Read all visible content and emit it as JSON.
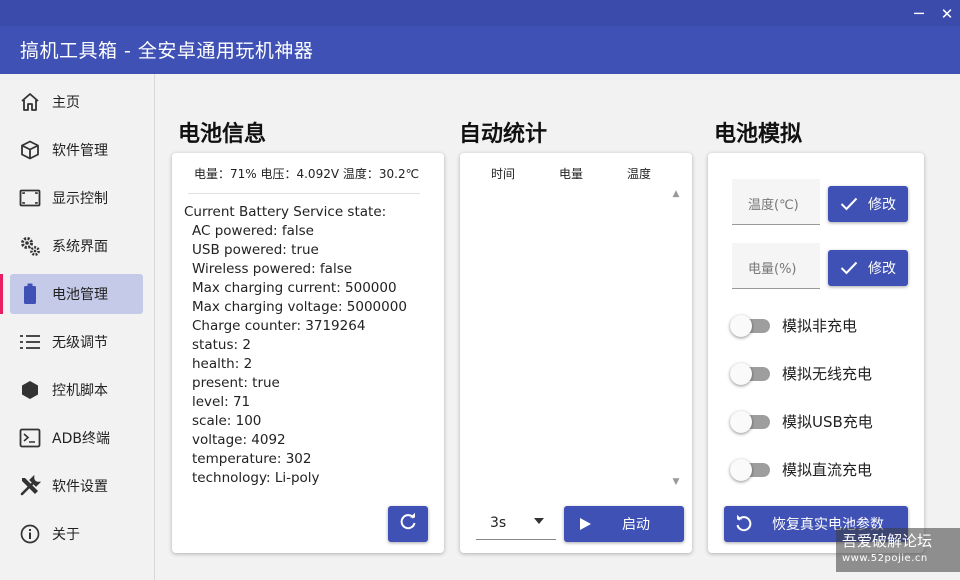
{
  "window": {
    "title": "搞机工具箱 - 全安卓通用玩机神器",
    "minimize_glyph": "─",
    "close_glyph": "✕"
  },
  "sidebar": {
    "active_index": 4,
    "items": [
      {
        "label": "主页",
        "icon": "home-icon"
      },
      {
        "label": "软件管理",
        "icon": "package-icon"
      },
      {
        "label": "显示控制",
        "icon": "screen-icon"
      },
      {
        "label": "系统界面",
        "icon": "gears-icon"
      },
      {
        "label": "电池管理",
        "icon": "battery-icon"
      },
      {
        "label": "无级调节",
        "icon": "list-icon"
      },
      {
        "label": "控机脚本",
        "icon": "hexagon-icon"
      },
      {
        "label": "ADB终端",
        "icon": "terminal-icon"
      },
      {
        "label": "软件设置",
        "icon": "tools-icon"
      },
      {
        "label": "关于",
        "icon": "info-icon"
      }
    ]
  },
  "battery_info": {
    "heading": "电池信息",
    "summary": "电量：71%  电压：4.092V  温度：30.2℃",
    "state_lines": [
      "Current Battery Service state:",
      "AC powered: false",
      "USB powered: true",
      "Wireless powered: false",
      "Max charging current: 500000",
      "Max charging voltage: 5000000",
      "Charge counter: 3719264",
      "status: 2",
      "health: 2",
      "present: true",
      "level: 71",
      "scale: 100",
      "voltage: 4092",
      "temperature: 302",
      "technology: Li-poly"
    ],
    "refresh_icon": "refresh-icon"
  },
  "auto_stats": {
    "heading": "自动统计",
    "columns": [
      "时间",
      "电量",
      "温度"
    ],
    "rows": [],
    "interval_value": "3s",
    "start_label": "启动"
  },
  "battery_sim": {
    "heading": "电池模拟",
    "temp_placeholder": "温度(℃)",
    "level_placeholder": "电量(%)",
    "modify_label": "修改",
    "toggles": [
      {
        "label": "模拟非充电",
        "on": false
      },
      {
        "label": "模拟无线充电",
        "on": false
      },
      {
        "label": "模拟USB充电",
        "on": false
      },
      {
        "label": "模拟直流充电",
        "on": false
      }
    ],
    "restore_label": "恢复真实电池参数"
  },
  "watermark": {
    "text": "吾爱破解论坛",
    "url": "www.52pojie.cn"
  },
  "colors": {
    "primary": "#3f51b5",
    "active_nav_bg": "#c5cae9",
    "active_indicator": "#e91e63"
  }
}
